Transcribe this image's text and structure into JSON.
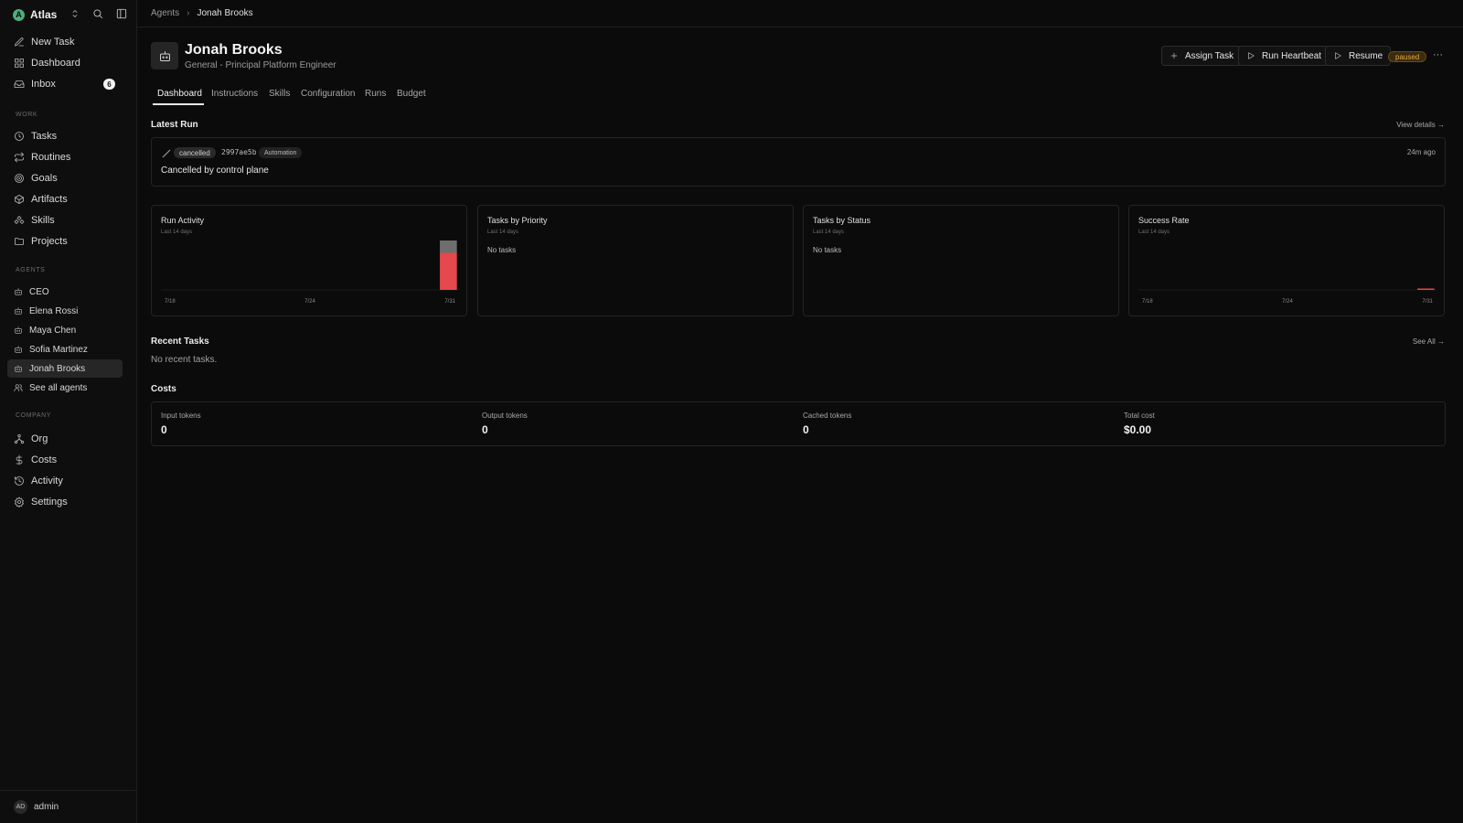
{
  "workspace": {
    "name": "Atlas",
    "initial": "A"
  },
  "sidebar": {
    "top_items": [
      {
        "label": "New Task",
        "icon": "edit-icon"
      },
      {
        "label": "Dashboard",
        "icon": "dashboard-icon"
      },
      {
        "label": "Inbox",
        "icon": "inbox-icon",
        "badge": "6"
      }
    ],
    "work_label": "WORK",
    "work_items": [
      {
        "label": "Tasks",
        "icon": "clock-icon"
      },
      {
        "label": "Routines",
        "icon": "repeat-icon"
      },
      {
        "label": "Goals",
        "icon": "target-icon"
      },
      {
        "label": "Artifacts",
        "icon": "box-icon"
      },
      {
        "label": "Skills",
        "icon": "skills-icon"
      },
      {
        "label": "Projects",
        "icon": "folder-icon"
      }
    ],
    "agents_label": "AGENTS",
    "agents": [
      {
        "label": "CEO"
      },
      {
        "label": "Elena Rossi"
      },
      {
        "label": "Maya Chen"
      },
      {
        "label": "Sofia Martinez"
      },
      {
        "label": "Jonah Brooks",
        "active": true
      }
    ],
    "see_all_agents": "See all agents",
    "company_label": "COMPANY",
    "company_items": [
      {
        "label": "Org",
        "icon": "org-icon"
      },
      {
        "label": "Costs",
        "icon": "dollar-icon"
      },
      {
        "label": "Activity",
        "icon": "history-icon"
      },
      {
        "label": "Settings",
        "icon": "gear-icon"
      }
    ],
    "user": {
      "initials": "AD",
      "name": "admin"
    }
  },
  "breadcrumb": {
    "parent": "Agents",
    "current": "Jonah Brooks"
  },
  "agent": {
    "name": "Jonah Brooks",
    "role": "General - Principal Platform Engineer",
    "status": "paused"
  },
  "actions": {
    "assign_task": "Assign Task",
    "run_heartbeat": "Run Heartbeat",
    "resume": "Resume",
    "more": "···"
  },
  "tabs": [
    "Dashboard",
    "Instructions",
    "Skills",
    "Configuration",
    "Runs",
    "Budget"
  ],
  "latest_run": {
    "title": "Latest Run",
    "view_details": "View details →",
    "status": "cancelled",
    "id": "2997ae5b",
    "tag": "Automation",
    "message": "Cancelled by control plane",
    "time": "24m ago"
  },
  "cards": {
    "run_activity": {
      "title": "Run Activity",
      "subtitle": "Last 14 days"
    },
    "tasks_by_priority": {
      "title": "Tasks by Priority",
      "subtitle": "Last 14 days",
      "empty": "No tasks"
    },
    "tasks_by_status": {
      "title": "Tasks by Status",
      "subtitle": "Last 14 days",
      "empty": "No tasks"
    },
    "success_rate": {
      "title": "Success Rate",
      "subtitle": "Last 14 days"
    }
  },
  "chart_data": [
    {
      "type": "bar",
      "title": "Run Activity",
      "x_ticks": [
        "7/18",
        "7/24",
        "7/31"
      ],
      "colors": {
        "cancelled": "#6e6e6e",
        "failed": "#e5484d"
      },
      "series": [
        {
          "name": "cancelled",
          "values": [
            0,
            0,
            0,
            0,
            0,
            0,
            0,
            0,
            0,
            0,
            0,
            0,
            0,
            1
          ]
        },
        {
          "name": "failed",
          "values": [
            0,
            0,
            0,
            0,
            0,
            0,
            0,
            0,
            0,
            0,
            0,
            0,
            0,
            3
          ]
        }
      ]
    },
    {
      "type": "bar",
      "title": "Success Rate",
      "x_ticks": [
        "7/18",
        "7/24",
        "7/31"
      ],
      "series": [
        {
          "values": [
            null,
            null,
            null,
            null,
            null,
            null,
            null,
            null,
            null,
            null,
            null,
            null,
            null,
            0
          ]
        }
      ],
      "color": "#e5484d"
    }
  ],
  "recent_tasks": {
    "title": "Recent Tasks",
    "see_all": "See All →",
    "empty": "No recent tasks."
  },
  "costs": {
    "title": "Costs",
    "items": [
      {
        "label": "Input tokens",
        "value": "0"
      },
      {
        "label": "Output tokens",
        "value": "0"
      },
      {
        "label": "Cached tokens",
        "value": "0"
      },
      {
        "label": "Total cost",
        "value": "$0.00"
      }
    ]
  }
}
